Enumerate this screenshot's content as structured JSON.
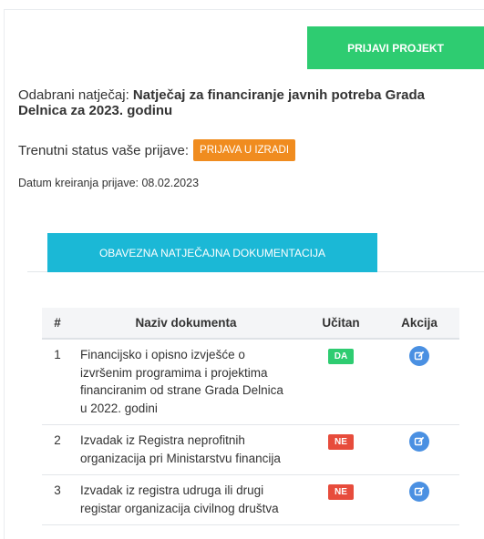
{
  "header": {
    "submit_label": "PRIJAVI PROJEKT"
  },
  "competition": {
    "prefix": "Odabrani natječaj: ",
    "name": "Natječaj za financiranje javnih potreba Grada Delnica za 2023. godinu"
  },
  "status": {
    "label": "Trenutni status vaše prijave:",
    "value": "PRIJAVA U IZRADI"
  },
  "created": {
    "text": "Datum kreiranja prijave: 08.02.2023"
  },
  "tabs": [
    {
      "label": "OBAVEZNA NATJEČAJNA DOKUMENTACIJA"
    }
  ],
  "table": {
    "headers": [
      "#",
      "Naziv dokumenta",
      "Učitan",
      "Akcija"
    ],
    "rows": [
      {
        "num": "1",
        "name": "Financijsko i opisno izvješće o izvršenim programima i projektima financiranim od strane Grada Delnica u 2022. godini",
        "uploaded": "DA"
      },
      {
        "num": "2",
        "name": "Izvadak iz Registra neprofitnih organizacija pri Ministarstvu financija",
        "uploaded": "NE"
      },
      {
        "num": "3",
        "name": "Izvadak iz registra udruga ili drugi registar organizacija civilnog društva",
        "uploaded": "NE"
      }
    ]
  },
  "icons": {
    "edit": "edit-icon"
  },
  "colors": {
    "submit": "#2ecc71",
    "status_badge": "#f08c1f",
    "tab": "#1bb8d6",
    "yes": "#2ecc71",
    "no": "#e74c3c",
    "action": "#4a90e2"
  }
}
